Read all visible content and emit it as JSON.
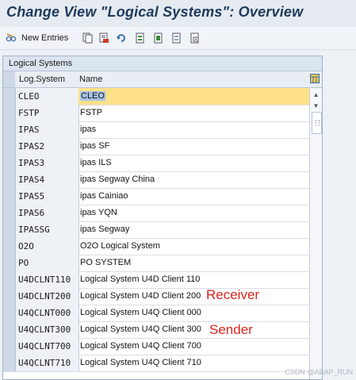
{
  "window": {
    "title": "Change View \"Logical Systems\": Overview"
  },
  "toolbar": {
    "new_entries_label": "New Entries"
  },
  "table": {
    "panel_title": "Logical Systems",
    "columns": [
      "Log.System",
      "Name"
    ],
    "rows": [
      {
        "code": "CLEO",
        "name": "CLEO",
        "active": true
      },
      {
        "code": "FSTP",
        "name": "FSTP"
      },
      {
        "code": "IPAS",
        "name": "ipas"
      },
      {
        "code": "IPAS2",
        "name": "ipas SF"
      },
      {
        "code": "IPAS3",
        "name": "ipas ILS"
      },
      {
        "code": "IPAS4",
        "name": "ipas Segway China"
      },
      {
        "code": "IPAS5",
        "name": "ipas Cainiao"
      },
      {
        "code": "IPAS6",
        "name": "ipas YQN"
      },
      {
        "code": "IPASSG",
        "name": "ipas Segway"
      },
      {
        "code": "O2O",
        "name": "O2O Logical System"
      },
      {
        "code": "PO",
        "name": "PO SYSTEM"
      },
      {
        "code": "U4DCLNT110",
        "name": "Logical System U4D Client 110"
      },
      {
        "code": "U4DCLNT200",
        "name": "Logical System U4D Client 200"
      },
      {
        "code": "U4QCLNT000",
        "name": "Logical System U4Q Client 000"
      },
      {
        "code": "U4QCLNT300",
        "name": "Logical System U4Q Client 300"
      },
      {
        "code": "U4QCLNT700",
        "name": "Logical System U4Q Client 700"
      },
      {
        "code": "U4QCLNT710",
        "name": "Logical System U4Q Client 710"
      }
    ]
  },
  "annotations": {
    "receiver": "Receiver",
    "sender": "Sender"
  },
  "watermark": "CSDN @ABAP_RUN",
  "colors": {
    "title": "#1d3a5c",
    "active_row": "#ffe18a",
    "annotation": "#d9261c"
  }
}
